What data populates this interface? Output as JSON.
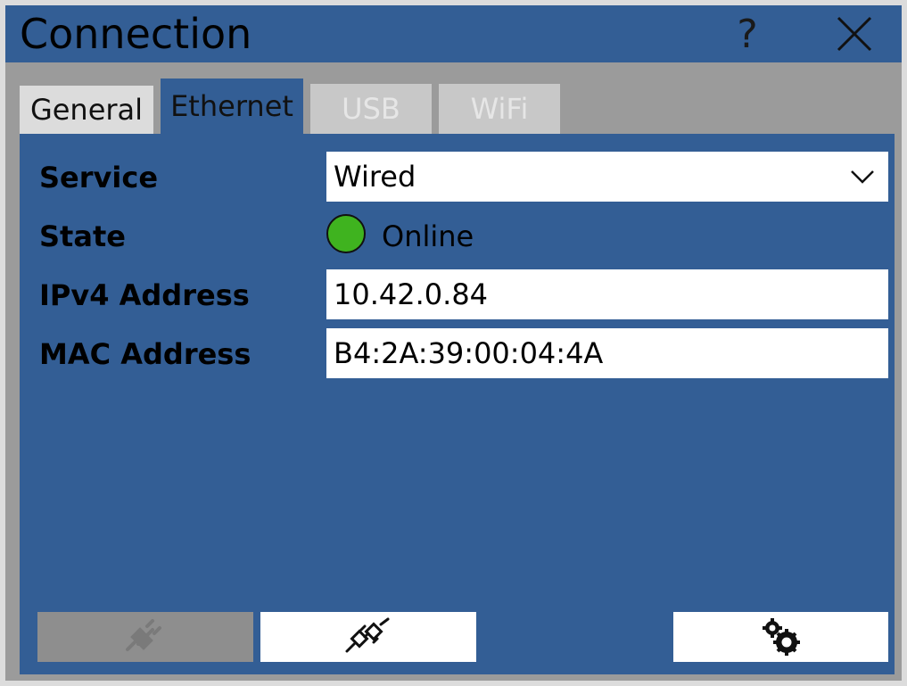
{
  "window": {
    "title": "Connection",
    "help_label": "?",
    "close_icon": "close-icon"
  },
  "tabs": [
    {
      "label": "General",
      "active": false,
      "enabled": true
    },
    {
      "label": "Ethernet",
      "active": true,
      "enabled": true
    },
    {
      "label": "USB",
      "active": false,
      "enabled": false
    },
    {
      "label": "WiFi",
      "active": false,
      "enabled": false
    }
  ],
  "form": {
    "service": {
      "label": "Service",
      "value": "Wired"
    },
    "state": {
      "label": "State",
      "value": "Online",
      "indicator_color": "#3fb31f"
    },
    "ipv4": {
      "label": "IPv4 Address",
      "value": "10.42.0.84"
    },
    "mac": {
      "label": "MAC Address",
      "value": "B4:2A:39:00:04:4A"
    }
  },
  "buttons": {
    "disconnect_icon": "plug-disconnect-icon",
    "connect_icon": "plug-connect-icon",
    "settings_icon": "gears-icon"
  },
  "colors": {
    "titlebar": "#335e95",
    "panel": "#335e95",
    "frame": "#9b9b9b"
  }
}
